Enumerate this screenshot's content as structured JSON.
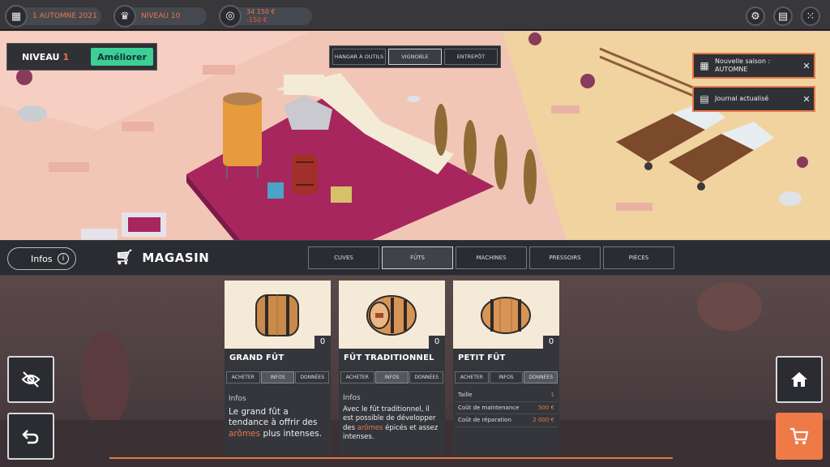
{
  "topbar": {
    "date": "1 AUTOMNE 2021",
    "level": "NIVEAU 10",
    "money": "34 150 €",
    "money_delta": "-150 €",
    "icons": [
      "calendar-icon",
      "crown-icon",
      "coins-icon",
      "gear-icon",
      "book-icon",
      "grid-menu-icon"
    ]
  },
  "level_box": {
    "label": "NIVEAU",
    "value": "1",
    "upgrade_label": "Améliorer"
  },
  "view_tabs": [
    {
      "label": "HANGAR À OUTILS",
      "active": false
    },
    {
      "label": "VIGNOBLE",
      "active": true
    },
    {
      "label": "ENTREPÔT",
      "active": false
    }
  ],
  "notifications": [
    {
      "text": "Nouvelle saison : AUTOMNE",
      "icon": "calendar-icon"
    },
    {
      "text": "Journal actualisé",
      "icon": "book-icon"
    }
  ],
  "shop": {
    "infos_label": "Infos",
    "title": "MAGASIN",
    "categories": [
      {
        "label": "CUVES",
        "active": false
      },
      {
        "label": "FÛTS",
        "active": true
      },
      {
        "label": "MACHINES",
        "active": false
      },
      {
        "label": "PRESSOIRS",
        "active": false
      },
      {
        "label": "PIÈCES",
        "active": false
      }
    ]
  },
  "products": [
    {
      "name": "GRAND FÛT",
      "count": "0",
      "tabs": [
        "ACHETER",
        "INFOS",
        "DONNÉES"
      ],
      "active_tab": "INFOS",
      "info_label": "Infos",
      "desc_pre": "Le grand fût a tendance à offrir des ",
      "desc_hl": "arômes",
      "desc_post": " plus intenses."
    },
    {
      "name": "FÛT TRADITIONNEL",
      "count": "0",
      "tabs": [
        "ACHETER",
        "INFOS",
        "DONNÉES"
      ],
      "active_tab": "INFOS",
      "info_label": "Infos",
      "desc_pre": "Avec le fût traditionnel, il est possible de développer des ",
      "desc_hl": "arômes",
      "desc_post": " épicés et assez intenses."
    },
    {
      "name": "PETIT FÛT",
      "count": "0",
      "tabs": [
        "ACHETER",
        "INFOS",
        "DONNÉES"
      ],
      "active_tab": "DONNÉES",
      "stats": [
        {
          "label": "Taille",
          "value": "1"
        },
        {
          "label": "Coût de maintenance",
          "value": "500 €"
        },
        {
          "label": "Coût de réparation",
          "value": "2 000 €"
        }
      ]
    }
  ],
  "side_buttons": {
    "hide": "eye-off-icon",
    "back": "undo-icon",
    "home": "home-icon",
    "cart": "cart-icon"
  },
  "colors": {
    "accent": "#e8784a",
    "upgrade": "#3ccf96",
    "panel": "#2a2c31"
  }
}
